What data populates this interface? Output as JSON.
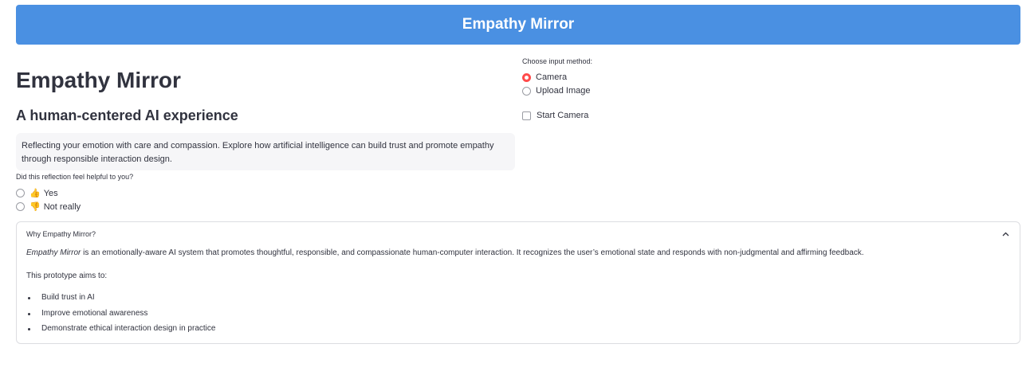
{
  "banner": {
    "title": "Empathy Mirror"
  },
  "main": {
    "title": "Empathy Mirror",
    "subtitle": "A human-centered AI experience",
    "description_line1": "Reflecting your emotion with care and compassion. Explore how artificial intelligence can build trust and promote empathy",
    "description_line2": "through responsible interaction design."
  },
  "feedback": {
    "question": "Did this reflection feel helpful to you?",
    "options": [
      {
        "emoji": "👍",
        "label": "Yes",
        "selected": false
      },
      {
        "emoji": "👎",
        "label": "Not really",
        "selected": false
      }
    ]
  },
  "input": {
    "label": "Choose input method:",
    "options": [
      {
        "label": "Camera",
        "selected": true
      },
      {
        "label": "Upload Image",
        "selected": false
      }
    ],
    "start_camera_label": "Start Camera",
    "start_camera_checked": false
  },
  "expander": {
    "title": "Why Empathy Mirror?",
    "expanded": true,
    "intro_emphasis": "Empathy Mirror",
    "intro_rest": " is an emotionally-aware AI system that promotes thoughtful, responsible, and compassionate human-computer interaction. It recognizes the user’s emotional state and responds with non-judgmental and affirming feedback.",
    "aims_label": "This prototype aims to:",
    "aims": [
      "Build trust in AI",
      "Improve emotional awareness",
      "Demonstrate ethical interaction design in practice"
    ]
  },
  "colors": {
    "banner": "#4a90e2",
    "accent": "#ff4b4b",
    "text": "#31333f",
    "info_box": "#f6f6f8"
  }
}
